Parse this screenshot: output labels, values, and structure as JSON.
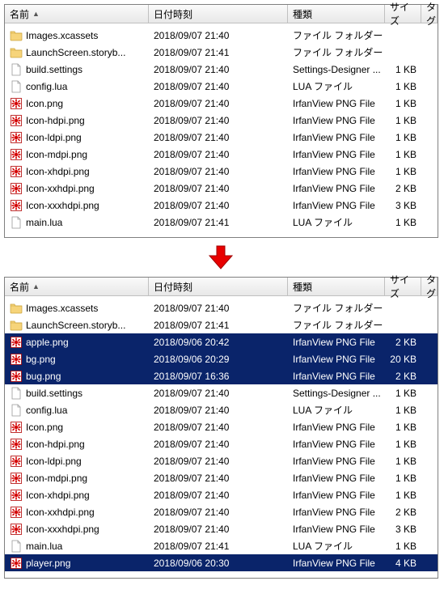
{
  "columns": {
    "name": "名前",
    "date": "日付時刻",
    "type": "種類",
    "size": "サイズ",
    "tag": "タグ"
  },
  "panels": [
    {
      "rows": [
        {
          "icon": "folder",
          "name": "Images.xcassets",
          "date": "2018/09/07 21:40",
          "type": "ファイル フォルダー",
          "size": "",
          "sel": false
        },
        {
          "icon": "folder",
          "name": "LaunchScreen.storyb...",
          "date": "2018/09/07 21:41",
          "type": "ファイル フォルダー",
          "size": "",
          "sel": false
        },
        {
          "icon": "file",
          "name": "build.settings",
          "date": "2018/09/07 21:40",
          "type": "Settings-Designer ...",
          "size": "1 KB",
          "sel": false
        },
        {
          "icon": "file",
          "name": "config.lua",
          "date": "2018/09/07 21:40",
          "type": "LUA ファイル",
          "size": "1 KB",
          "sel": false
        },
        {
          "icon": "png",
          "name": "Icon.png",
          "date": "2018/09/07 21:40",
          "type": "IrfanView PNG File",
          "size": "1 KB",
          "sel": false
        },
        {
          "icon": "png",
          "name": "Icon-hdpi.png",
          "date": "2018/09/07 21:40",
          "type": "IrfanView PNG File",
          "size": "1 KB",
          "sel": false
        },
        {
          "icon": "png",
          "name": "Icon-ldpi.png",
          "date": "2018/09/07 21:40",
          "type": "IrfanView PNG File",
          "size": "1 KB",
          "sel": false
        },
        {
          "icon": "png",
          "name": "Icon-mdpi.png",
          "date": "2018/09/07 21:40",
          "type": "IrfanView PNG File",
          "size": "1 KB",
          "sel": false
        },
        {
          "icon": "png",
          "name": "Icon-xhdpi.png",
          "date": "2018/09/07 21:40",
          "type": "IrfanView PNG File",
          "size": "1 KB",
          "sel": false
        },
        {
          "icon": "png",
          "name": "Icon-xxhdpi.png",
          "date": "2018/09/07 21:40",
          "type": "IrfanView PNG File",
          "size": "2 KB",
          "sel": false
        },
        {
          "icon": "png",
          "name": "Icon-xxxhdpi.png",
          "date": "2018/09/07 21:40",
          "type": "IrfanView PNG File",
          "size": "3 KB",
          "sel": false
        },
        {
          "icon": "file",
          "name": "main.lua",
          "date": "2018/09/07 21:41",
          "type": "LUA ファイル",
          "size": "1 KB",
          "sel": false
        }
      ]
    },
    {
      "rows": [
        {
          "icon": "folder",
          "name": "Images.xcassets",
          "date": "2018/09/07 21:40",
          "type": "ファイル フォルダー",
          "size": "",
          "sel": false
        },
        {
          "icon": "folder",
          "name": "LaunchScreen.storyb...",
          "date": "2018/09/07 21:41",
          "type": "ファイル フォルダー",
          "size": "",
          "sel": false
        },
        {
          "icon": "png",
          "name": "apple.png",
          "date": "2018/09/06 20:42",
          "type": "IrfanView PNG File",
          "size": "2 KB",
          "sel": true
        },
        {
          "icon": "png",
          "name": "bg.png",
          "date": "2018/09/06 20:29",
          "type": "IrfanView PNG File",
          "size": "20 KB",
          "sel": true
        },
        {
          "icon": "png",
          "name": "bug.png",
          "date": "2018/09/07 16:36",
          "type": "IrfanView PNG File",
          "size": "2 KB",
          "sel": true
        },
        {
          "icon": "file",
          "name": "build.settings",
          "date": "2018/09/07 21:40",
          "type": "Settings-Designer ...",
          "size": "1 KB",
          "sel": false
        },
        {
          "icon": "file",
          "name": "config.lua",
          "date": "2018/09/07 21:40",
          "type": "LUA ファイル",
          "size": "1 KB",
          "sel": false
        },
        {
          "icon": "png",
          "name": "Icon.png",
          "date": "2018/09/07 21:40",
          "type": "IrfanView PNG File",
          "size": "1 KB",
          "sel": false
        },
        {
          "icon": "png",
          "name": "Icon-hdpi.png",
          "date": "2018/09/07 21:40",
          "type": "IrfanView PNG File",
          "size": "1 KB",
          "sel": false
        },
        {
          "icon": "png",
          "name": "Icon-ldpi.png",
          "date": "2018/09/07 21:40",
          "type": "IrfanView PNG File",
          "size": "1 KB",
          "sel": false
        },
        {
          "icon": "png",
          "name": "Icon-mdpi.png",
          "date": "2018/09/07 21:40",
          "type": "IrfanView PNG File",
          "size": "1 KB",
          "sel": false
        },
        {
          "icon": "png",
          "name": "Icon-xhdpi.png",
          "date": "2018/09/07 21:40",
          "type": "IrfanView PNG File",
          "size": "1 KB",
          "sel": false
        },
        {
          "icon": "png",
          "name": "Icon-xxhdpi.png",
          "date": "2018/09/07 21:40",
          "type": "IrfanView PNG File",
          "size": "2 KB",
          "sel": false
        },
        {
          "icon": "png",
          "name": "Icon-xxxhdpi.png",
          "date": "2018/09/07 21:40",
          "type": "IrfanView PNG File",
          "size": "3 KB",
          "sel": false
        },
        {
          "icon": "file",
          "name": "main.lua",
          "date": "2018/09/07 21:41",
          "type": "LUA ファイル",
          "size": "1 KB",
          "sel": false
        },
        {
          "icon": "png",
          "name": "player.png",
          "date": "2018/09/06 20:30",
          "type": "IrfanView PNG File",
          "size": "4 KB",
          "sel": true
        }
      ]
    }
  ]
}
